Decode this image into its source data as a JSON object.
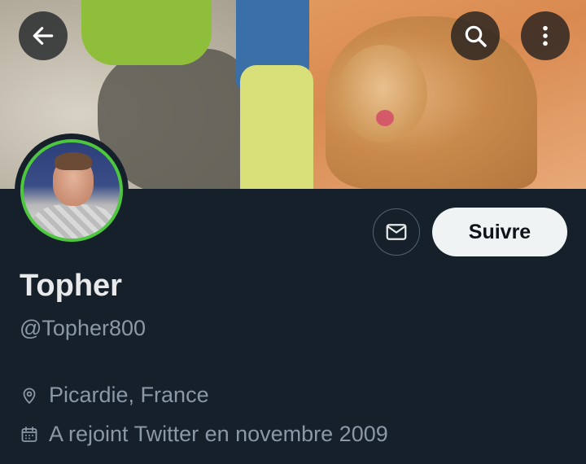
{
  "header": {
    "banner_description_icon": "banner-image",
    "back_icon": "arrow-left-icon",
    "search_icon": "search-icon",
    "more_icon": "more-vertical-icon"
  },
  "profile": {
    "display_name": "Topher",
    "handle": "@Topher800",
    "location": "Picardie, France",
    "joined": "A rejoint Twitter en novembre 2009"
  },
  "actions": {
    "message_icon": "envelope-icon",
    "follow_label": "Suivre"
  },
  "colors": {
    "background": "#15202b",
    "avatar_ring": "#4dc83e",
    "secondary_text": "#8b98a5",
    "primary_text": "#e7e9ea",
    "follow_bg": "#eff3f4"
  }
}
